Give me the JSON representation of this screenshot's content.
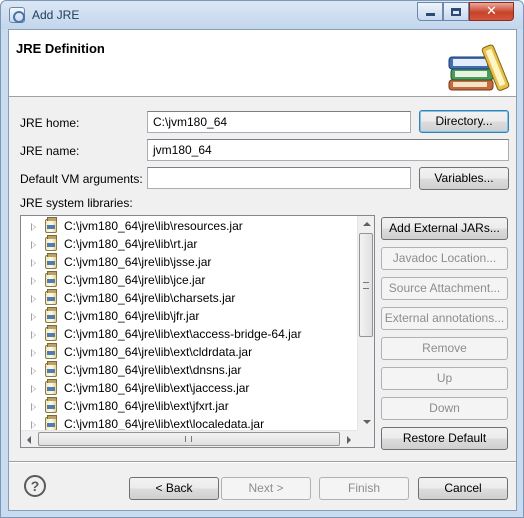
{
  "window": {
    "title": "Add JRE"
  },
  "header": {
    "title": "JRE Definition",
    "icon": "books-icon"
  },
  "form": {
    "jre_home": {
      "label": "JRE home:",
      "value": "C:\\jvm180_64"
    },
    "jre_name": {
      "label": "JRE name:",
      "value": "jvm180_64"
    },
    "vm_args": {
      "label": "Default VM arguments:",
      "value": ""
    },
    "libraries_label": "JRE system libraries:"
  },
  "buttons": {
    "directory": "Directory...",
    "variables": "Variables...",
    "add_external_jars": "Add External JARs...",
    "javadoc_location": "Javadoc Location...",
    "source_attachment": "Source Attachment...",
    "external_annotations": "External annotations...",
    "remove": "Remove",
    "up": "Up",
    "down": "Down",
    "restore_default": "Restore Default",
    "back": "< Back",
    "next": "Next >",
    "finish": "Finish",
    "cancel": "Cancel"
  },
  "libraries": [
    "C:\\jvm180_64\\jre\\lib\\resources.jar",
    "C:\\jvm180_64\\jre\\lib\\rt.jar",
    "C:\\jvm180_64\\jre\\lib\\jsse.jar",
    "C:\\jvm180_64\\jre\\lib\\jce.jar",
    "C:\\jvm180_64\\jre\\lib\\charsets.jar",
    "C:\\jvm180_64\\jre\\lib\\jfr.jar",
    "C:\\jvm180_64\\jre\\lib\\ext\\access-bridge-64.jar",
    "C:\\jvm180_64\\jre\\lib\\ext\\cldrdata.jar",
    "C:\\jvm180_64\\jre\\lib\\ext\\dnsns.jar",
    "C:\\jvm180_64\\jre\\lib\\ext\\jaccess.jar",
    "C:\\jvm180_64\\jre\\lib\\ext\\jfxrt.jar",
    "C:\\jvm180_64\\jre\\lib\\ext\\localedata.jar"
  ],
  "colors": {
    "title_bar": "#c9dbef",
    "close_button": "#c7432c",
    "default_button_border": "#3c7fb1"
  }
}
